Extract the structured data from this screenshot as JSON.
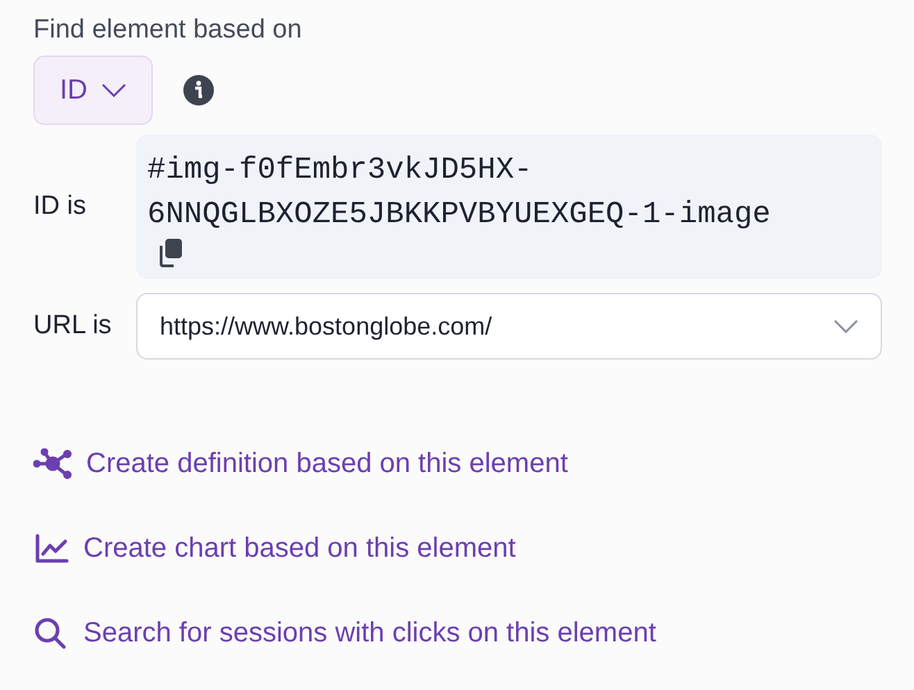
{
  "heading": "Find element based on",
  "selector": {
    "value": "ID"
  },
  "id_row": {
    "label": "ID is",
    "value": "#img-f0fEmbr3vkJD5HX-6NNQGLBXOZE5JBKKPVBYUEXGEQ-1-image"
  },
  "url_row": {
    "label": "URL is",
    "value": "https://www.bostonglobe.com/"
  },
  "actions": [
    {
      "kind": "definition",
      "label": "Create definition based on this element"
    },
    {
      "kind": "chart",
      "label": "Create chart based on this element"
    },
    {
      "kind": "search",
      "label": "Search for sessions with clicks on this element"
    }
  ]
}
